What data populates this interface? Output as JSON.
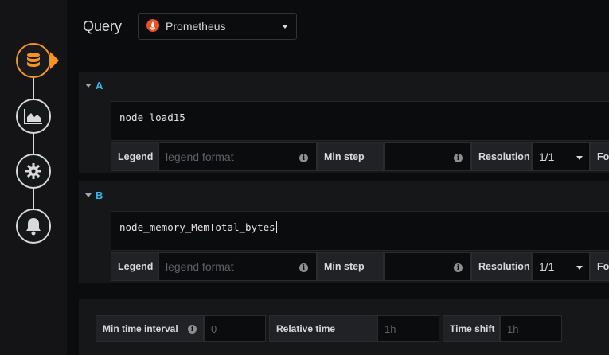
{
  "sidebar": {
    "items": [
      {
        "name": "queries",
        "icon": "database-icon",
        "active": true
      },
      {
        "name": "visualization",
        "icon": "chart-area-icon",
        "active": false
      },
      {
        "name": "general",
        "icon": "gear-icon",
        "active": false
      },
      {
        "name": "alert",
        "icon": "bell-icon",
        "active": false
      }
    ]
  },
  "header": {
    "title": "Query",
    "datasource": "Prometheus",
    "datasource_icon": "prometheus-icon"
  },
  "queries": [
    {
      "ref": "A",
      "expr": "node_load15",
      "legend_label": "Legend",
      "legend_placeholder": "legend format",
      "min_step_label": "Min step",
      "min_step_value": "",
      "resolution_label": "Resolution",
      "resolution_value": "1/1",
      "format_label_partial": "Fo"
    },
    {
      "ref": "B",
      "expr": "node_memory_MemTotal_bytes",
      "legend_label": "Legend",
      "legend_placeholder": "legend format",
      "min_step_label": "Min step",
      "min_step_value": "",
      "resolution_label": "Resolution",
      "resolution_value": "1/1",
      "format_label_partial": "Fo"
    }
  ],
  "options": {
    "min_interval_label": "Min time interval",
    "min_interval_placeholder": "0",
    "relative_time_label": "Relative time",
    "relative_time_placeholder": "1h",
    "time_shift_label": "Time shift",
    "time_shift_placeholder": "1h"
  },
  "colors": {
    "accent": "#f7941d",
    "query_ref": "#33b5e5",
    "prometheus": "#e6522c"
  }
}
